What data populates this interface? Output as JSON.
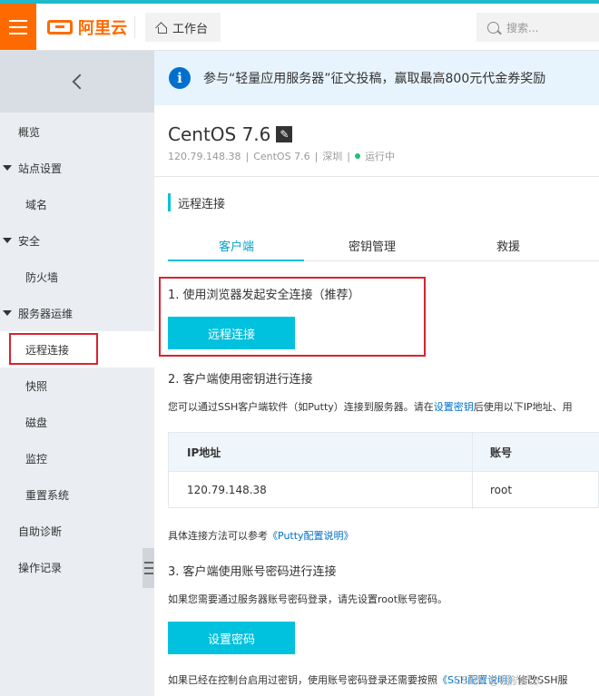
{
  "topbar": {
    "menu_icon": "hamburger-icon",
    "logo_text": "阿里云",
    "workbench_label": "工作台",
    "search_placeholder": "搜索...",
    "colors": {
      "menu_bg": "#ff6a00",
      "accent_line": "#1fb9c9"
    }
  },
  "sidebar": {
    "collapse_icon": "chevron-left-icon",
    "items": [
      {
        "label": "概览"
      },
      {
        "label": "站点设置"
      },
      {
        "label": "域名"
      },
      {
        "label": "安全"
      },
      {
        "label": "防火墙"
      },
      {
        "label": "服务器运维"
      },
      {
        "label": "远程连接"
      },
      {
        "label": "快照"
      },
      {
        "label": "磁盘"
      },
      {
        "label": "监控"
      },
      {
        "label": "重置系统"
      },
      {
        "label": "自助诊断"
      },
      {
        "label": "操作记录"
      }
    ]
  },
  "notice": {
    "text": "参与“轻量应用服务器”征文投稿，赢取最高800元代金券奖励"
  },
  "instance": {
    "title": "CentOS 7.6",
    "ip": "120.79.148.38",
    "os": "CentOS 7.6",
    "region": "深圳",
    "status": "运行中",
    "sep": "|"
  },
  "remote": {
    "section_title": "远程连接",
    "tabs": [
      "客户端",
      "密钥管理",
      "救援"
    ],
    "step1_title": "1. 使用浏览器发起安全连接（推荐）",
    "step1_button": "远程连接",
    "step2_title": "2. 客户端使用密钥进行连接",
    "step2_desc_pre": "您可以通过SSH客户端软件（如Putty）连接到服务器。请在",
    "step2_desc_link": "设置密钥",
    "step2_desc_post": "后使用以下IP地址、用",
    "table": {
      "headers": [
        "IP地址",
        "账号"
      ],
      "row": [
        "120.79.148.38",
        "root"
      ]
    },
    "ref_pre": "具体连接方法可以参考",
    "ref_link": "《Putty配置说明》",
    "step3_title": "3. 客户端使用账号密码进行连接",
    "step3_desc": "如果您需要通过服务器账号密码登录，请先设置root账号密码。",
    "step3_button": "设置密码",
    "bottom_desc": "如果已经在控制台启用过密钥，使用账号密码登录还需要按照",
    "bottom_link": "《SSH配置说明》",
    "bottom_post": "修改SSH服"
  },
  "watermark": "CSDN @明航航长"
}
